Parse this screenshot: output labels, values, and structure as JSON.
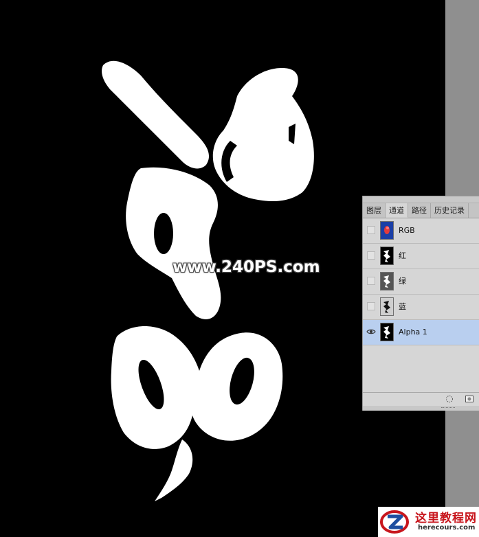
{
  "watermark": {
    "text": "www.240PS.com"
  },
  "channels_panel": {
    "tabs": [
      {
        "label": "图层",
        "active": false
      },
      {
        "label": "通道",
        "active": true
      },
      {
        "label": "路径",
        "active": false
      },
      {
        "label": "历史记录",
        "active": false
      }
    ],
    "channels": [
      {
        "label": "RGB",
        "visible": false,
        "selected": false,
        "thumbnail": "rgb-composite"
      },
      {
        "label": "红",
        "visible": false,
        "selected": false,
        "thumbnail": "red-channel"
      },
      {
        "label": "绿",
        "visible": false,
        "selected": false,
        "thumbnail": "green-channel"
      },
      {
        "label": "蓝",
        "visible": false,
        "selected": false,
        "thumbnail": "blue-channel"
      },
      {
        "label": "Alpha 1",
        "visible": true,
        "selected": true,
        "thumbnail": "alpha-channel"
      }
    ],
    "bottom_icons": [
      "load-selection-icon",
      "save-selection-icon"
    ]
  },
  "logo": {
    "title": "这里教程网",
    "url": "herecours.com"
  },
  "colors": {
    "canvas": "#000000",
    "panel": "#d6d6d6",
    "selected_row": "#b9cfef",
    "gutter": "#8f8f8f"
  }
}
